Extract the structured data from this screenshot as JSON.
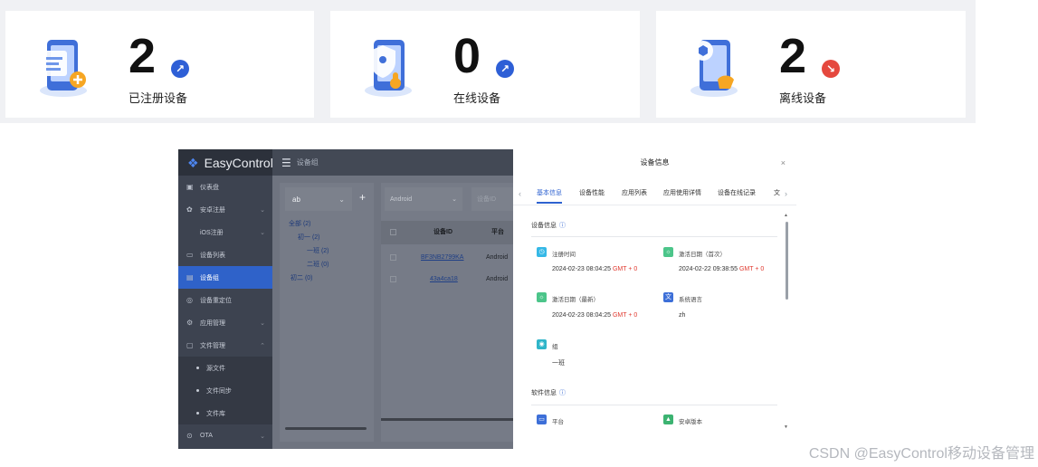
{
  "stats": [
    {
      "value": "2",
      "label": "已注册设备",
      "trend": "up",
      "trend_icon": "↗"
    },
    {
      "value": "0",
      "label": "在线设备",
      "trend": "up",
      "trend_icon": "↗"
    },
    {
      "value": "2",
      "label": "离线设备",
      "trend": "down",
      "trend_icon": "↘"
    }
  ],
  "app": {
    "brand": "EasyControl",
    "topbar_title": "设备组",
    "menu": [
      {
        "label": "仪表盘",
        "icon": "dashboard-icon",
        "glyph": "▣"
      },
      {
        "label": "安卓注册",
        "icon": "android-icon",
        "glyph": "✿",
        "chevron": "⌄"
      },
      {
        "label": "iOS注册",
        "icon": "apple-icon",
        "glyph": "",
        "chevron": "⌄"
      },
      {
        "label": "设备列表",
        "icon": "device-list-icon",
        "glyph": "▭"
      },
      {
        "label": "设备组",
        "icon": "group-icon",
        "glyph": "▤",
        "active": true
      },
      {
        "label": "设备重定位",
        "icon": "locate-icon",
        "glyph": "◎"
      },
      {
        "label": "应用管理",
        "icon": "app-icon",
        "glyph": "⚙",
        "chevron": "⌄"
      },
      {
        "label": "文件管理",
        "icon": "folder-icon",
        "glyph": "▢",
        "chevron": "⌃"
      },
      {
        "label": "源文件",
        "sub": true
      },
      {
        "label": "文件同步",
        "sub": true
      },
      {
        "label": "文件库",
        "sub": true
      },
      {
        "label": "OTA",
        "icon": "ota-icon",
        "glyph": "⊙",
        "chevron": "⌄"
      }
    ],
    "tree": {
      "select_value": "ab",
      "add": "+",
      "nodes": [
        "全部 (2)",
        "初一 (2)",
        "一班 (2)",
        "二班 (0)",
        "初二 (0)"
      ]
    },
    "list": {
      "platform_filter": "Android",
      "id_filter_placeholder": "设备ID",
      "columns": [
        "设备ID",
        "平台"
      ],
      "rows": [
        {
          "id": "BF3NB2799KA",
          "platform": "Android"
        },
        {
          "id": "43a4ca18",
          "platform": "Android"
        }
      ]
    },
    "drawer": {
      "title": "设备信息",
      "close": "×",
      "tabs": [
        "基本信息",
        "设备性能",
        "应用列表",
        "应用使用详情",
        "设备在线记录",
        "文"
      ],
      "active_tab": 0,
      "device_section": "设备信息",
      "fields": [
        {
          "label": "注册时间",
          "value": "2024-02-23 08:04:25",
          "gmt": "GMT + 0",
          "icon": "clock-icon",
          "color": "#35b8e6"
        },
        {
          "label": "激活日期（首次）",
          "value": "2024-02-22 09:38:55",
          "gmt": "GMT + 0",
          "icon": "activate-icon",
          "color": "#4cc58a"
        },
        {
          "label": "激活日期（最新）",
          "value": "2024-02-23 08:04:25",
          "gmt": "GMT + 0",
          "icon": "activate-latest-icon",
          "color": "#4cc58a"
        },
        {
          "label": "系统语言",
          "value": "zh",
          "gmt": "",
          "icon": "language-icon",
          "color": "#3d6fd8"
        },
        {
          "label": "组",
          "value": "一班",
          "gmt": "",
          "icon": "group-icon",
          "color": "#2fb5c9"
        }
      ],
      "software_section": "软件信息",
      "software_fields": [
        {
          "label": "平台",
          "icon": "platform-icon",
          "color": "#3d6fd8"
        },
        {
          "label": "安卓版本",
          "icon": "android-version-icon",
          "color": "#3cb371"
        }
      ]
    }
  },
  "watermark": "CSDN @EasyControl移动设备管理"
}
